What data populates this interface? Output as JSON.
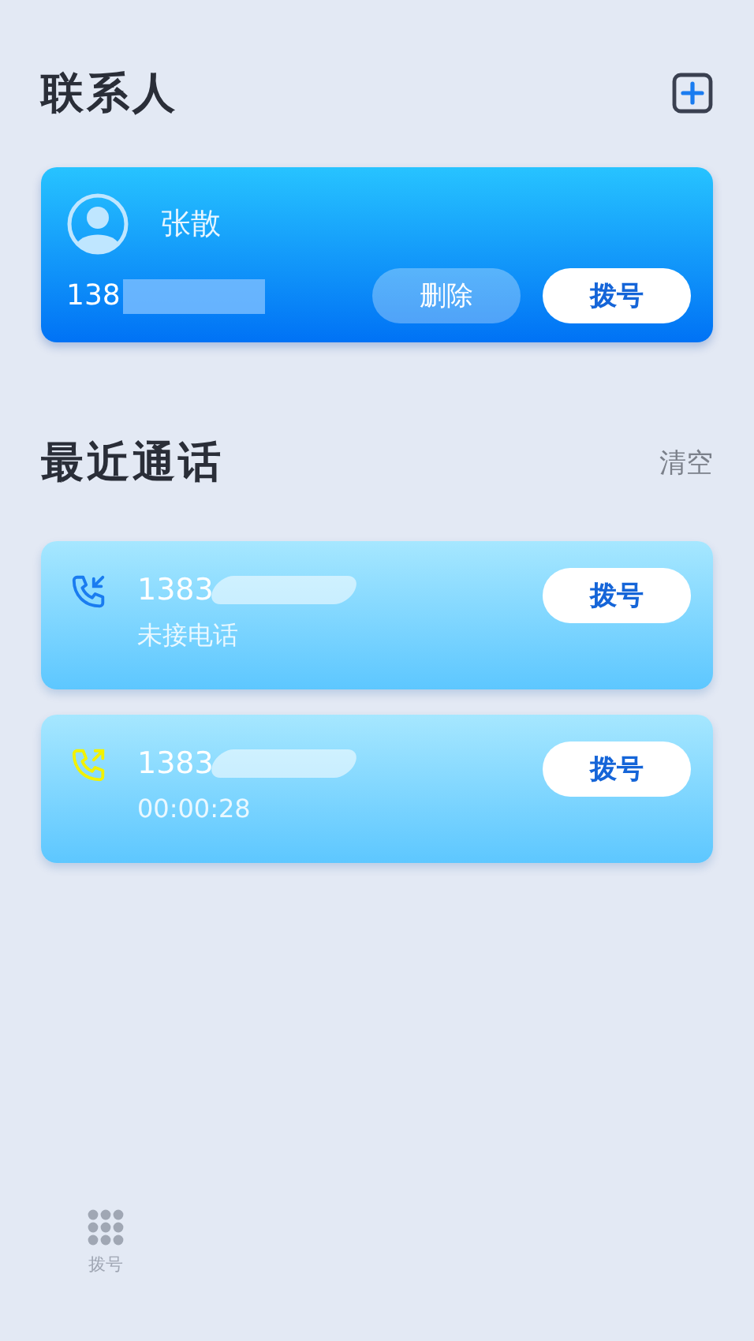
{
  "contacts": {
    "title": "联系人",
    "list": [
      {
        "name": "张散",
        "number": "138",
        "delete_label": "删除",
        "dial_label": "拨号"
      }
    ]
  },
  "recent": {
    "title": "最近通话",
    "clear_label": "清空",
    "calls": [
      {
        "kind": "missed",
        "color": "#1a7cf0",
        "number": "1383",
        "detail": "未接电话",
        "dial_label": "拨号"
      },
      {
        "kind": "outgoing",
        "color": "#f2f200",
        "number": "1383",
        "detail": "00:00:28",
        "dial_label": "拨号"
      }
    ]
  },
  "bottom_nav": {
    "items": [
      {
        "label": "拨号"
      }
    ]
  }
}
